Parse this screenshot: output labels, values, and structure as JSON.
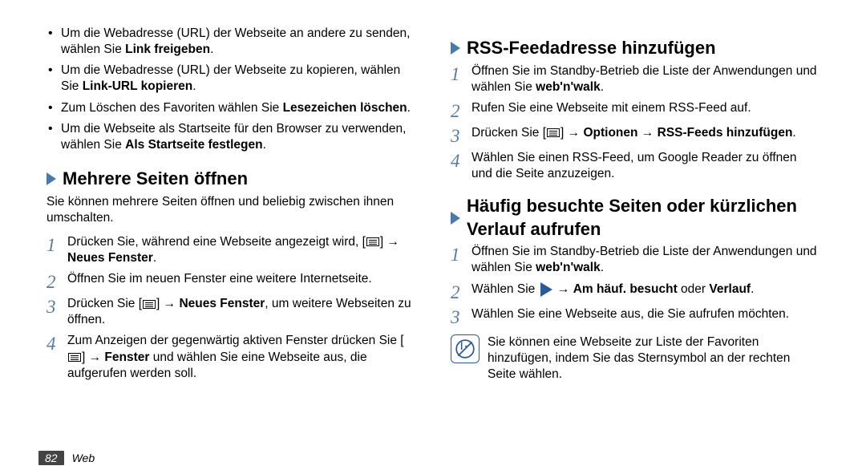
{
  "left": {
    "bullets": [
      {
        "pre": "Um die Webadresse (URL) der Webseite an andere zu senden, wählen Sie ",
        "bold": "Link freigeben",
        "post": "."
      },
      {
        "pre": "Um die Webadresse (URL) der Webseite zu kopieren, wählen Sie ",
        "bold": "Link-URL kopieren",
        "post": "."
      },
      {
        "pre": "Zum Löschen des Favoriten wählen Sie ",
        "bold": "Lesezeichen löschen",
        "post": "."
      },
      {
        "pre": "Um die Webseite als Startseite für den Browser zu verwenden, wählen Sie ",
        "bold": "Als Startseite festlegen",
        "post": "."
      }
    ],
    "section_title": "Mehrere Seiten öffnen",
    "intro": "Sie können mehrere Seiten öffnen und beliebig zwischen ihnen umschalten.",
    "steps": {
      "s1_pre": "Drücken Sie, während eine Webseite angezeigt wird, [",
      "s1_post": "] → ",
      "s1_bold": "Neues Fenster",
      "s1_end": ".",
      "s2": "Öffnen Sie im neuen Fenster eine weitere Internetseite.",
      "s3_pre": "Drücken Sie [",
      "s3_post": "] → ",
      "s3_bold": "Neues Fenster",
      "s3_end": ", um weitere Webseiten zu öffnen.",
      "s4_pre": "Zum Anzeigen der gegenwärtig aktiven Fenster drücken Sie [",
      "s4_post": "] → ",
      "s4_bold": "Fenster",
      "s4_end": " und wählen Sie eine Webseite aus, die aufgerufen werden soll."
    }
  },
  "right": {
    "section1_title": "RSS-Feedadresse hinzufügen",
    "s1": {
      "a_pre": "Öffnen Sie im Standby-Betrieb die Liste der Anwendungen und wählen Sie ",
      "a_bold": "web'n'walk",
      "a_post": ".",
      "b": "Rufen Sie eine Webseite mit einem RSS-Feed auf.",
      "c_pre": "Drücken Sie [",
      "c_post": "] → ",
      "c_bold1": "Optionen",
      "c_arrow": " → ",
      "c_bold2": "RSS-Feeds hinzufügen",
      "c_end": ".",
      "d": "Wählen Sie einen RSS-Feed, um Google Reader zu öffnen und die Seite anzuzeigen."
    },
    "section2_title": "Häufig besuchte Seiten oder kürzlichen Verlauf aufrufen",
    "s2": {
      "a_pre": "Öffnen Sie im Standby-Betrieb die Liste der Anwendungen und wählen Sie ",
      "a_bold": "web'n'walk",
      "a_post": ".",
      "b_pre": "Wählen Sie ",
      "b_post": " → ",
      "b_bold1": "Am häuf. besucht",
      "b_mid": " oder ",
      "b_bold2": "Verlauf",
      "b_end": ".",
      "c": "Wählen Sie eine Webseite aus, die Sie aufrufen möchten."
    },
    "note": "Sie können eine Webseite zur Liste der Favoriten hinzufügen, indem Sie das Sternsymbol an der rechten Seite wählen."
  },
  "footer": {
    "page_num": "82",
    "section": "Web"
  }
}
